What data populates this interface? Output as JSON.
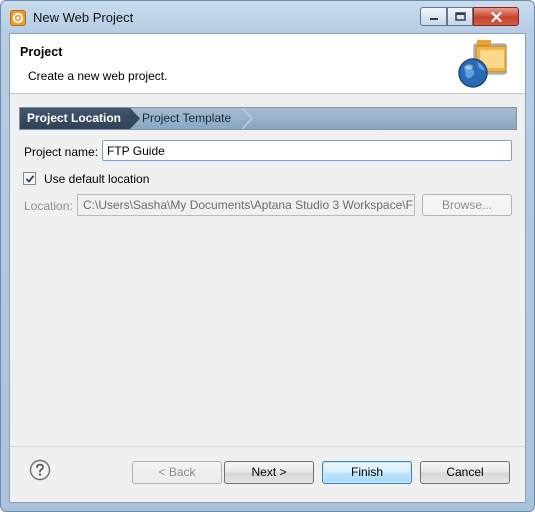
{
  "window": {
    "title": "New Web Project"
  },
  "header": {
    "title": "Project",
    "description": "Create a new web project."
  },
  "wizard": {
    "steps": [
      {
        "label": "Project Location",
        "active": true
      },
      {
        "label": "Project Template",
        "active": false
      }
    ]
  },
  "form": {
    "project_name_label": "Project name:",
    "project_name_value": "FTP Guide",
    "use_default_label": "Use default location",
    "use_default_checked": true,
    "location_label": "Location:",
    "location_value": "C:\\Users\\Sasha\\My Documents\\Aptana Studio 3 Workspace\\F",
    "browse_label": "Browse..."
  },
  "footer": {
    "back_label": "< Back",
    "next_label": "Next >",
    "finish_label": "Finish",
    "cancel_label": "Cancel"
  },
  "icons": {
    "app": "gear-icon",
    "header": "folder-globe-icon",
    "help": "help-icon"
  },
  "colors": {
    "breadcrumb_active": "#2e4256",
    "breadcrumb_bar": "#8aa7c1",
    "finish_accent": "#3c7fb1",
    "close_button": "#c5452e"
  }
}
